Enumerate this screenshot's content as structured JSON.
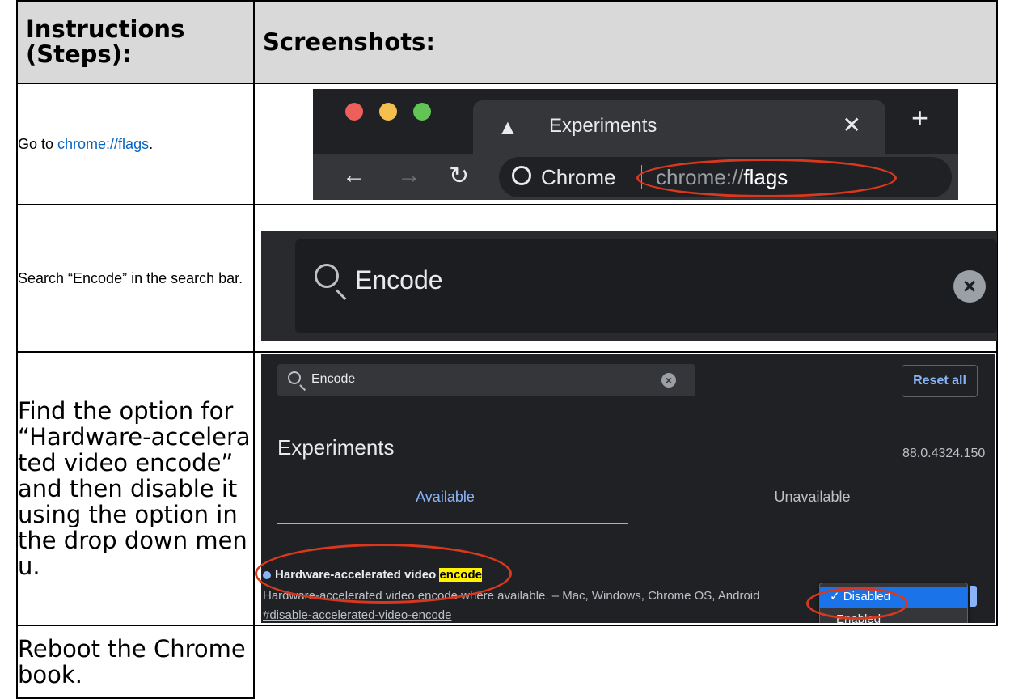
{
  "table": {
    "header_steps": "Instructions (Steps):",
    "header_screens": "Screenshots:"
  },
  "rows": [
    {
      "prefix": "Go to ",
      "link": "chrome://flags",
      "suffix": "."
    },
    {
      "text": "Search “Encode” in the search bar."
    },
    {
      "text": "Find the option for “Hardware-accelerated video encode” and then disable it using the option in the drop down menu."
    },
    {
      "text": "Reboot the Chromebook."
    }
  ],
  "shot1": {
    "tab_title": "Experiments",
    "omnibox_label": "Chrome",
    "url_prefix": "chrome://",
    "url_bold": "flags"
  },
  "shot2": {
    "query": "Encode"
  },
  "shot3": {
    "query": "Encode",
    "reset_label": "Reset all",
    "title": "Experiments",
    "version": "88.0.4324.150",
    "tab_available": "Available",
    "tab_unavailable": "Unavailable",
    "flag_name": "Hardware-accelerated video ",
    "flag_name_highlight": "encode",
    "flag_desc": "Hardware-accelerated video encode where available. – Mac, Windows, Chrome OS, Android",
    "flag_id": "#disable-accelerated-video-encode",
    "option_selected": "✓ Disabled",
    "option_other": "Enabled"
  },
  "colors": {
    "annotation_red": "#d9381e",
    "header_gray": "#d9d9d9",
    "link_blue": "#0563c1",
    "chrome_dark": "#202124",
    "highlight_yellow": "#fff200"
  }
}
